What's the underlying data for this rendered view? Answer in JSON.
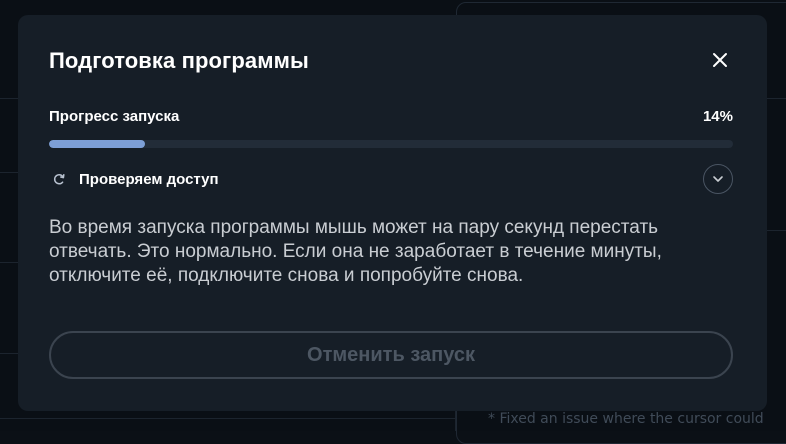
{
  "background": {
    "footer_note": "* Fixed an issue where the cursor could"
  },
  "modal": {
    "title": "Подготовка программы",
    "close_icon": "close-icon",
    "progress": {
      "label": "Прогресс запуска",
      "percent_text": "14%",
      "value": 0.14,
      "fill_color": "#7d9fd6"
    },
    "step": {
      "icon": "spinner-icon",
      "label": "Проверяем доступ",
      "expand_icon": "chevron-down-icon"
    },
    "description": "Во время запуска программы мышь может на пару секунд перестать отвечать. Это нормально. Если она не заработает в течение минуты, отключите её, подключите снова и попробуйте снова.",
    "cancel_label": "Отменить запуск"
  }
}
